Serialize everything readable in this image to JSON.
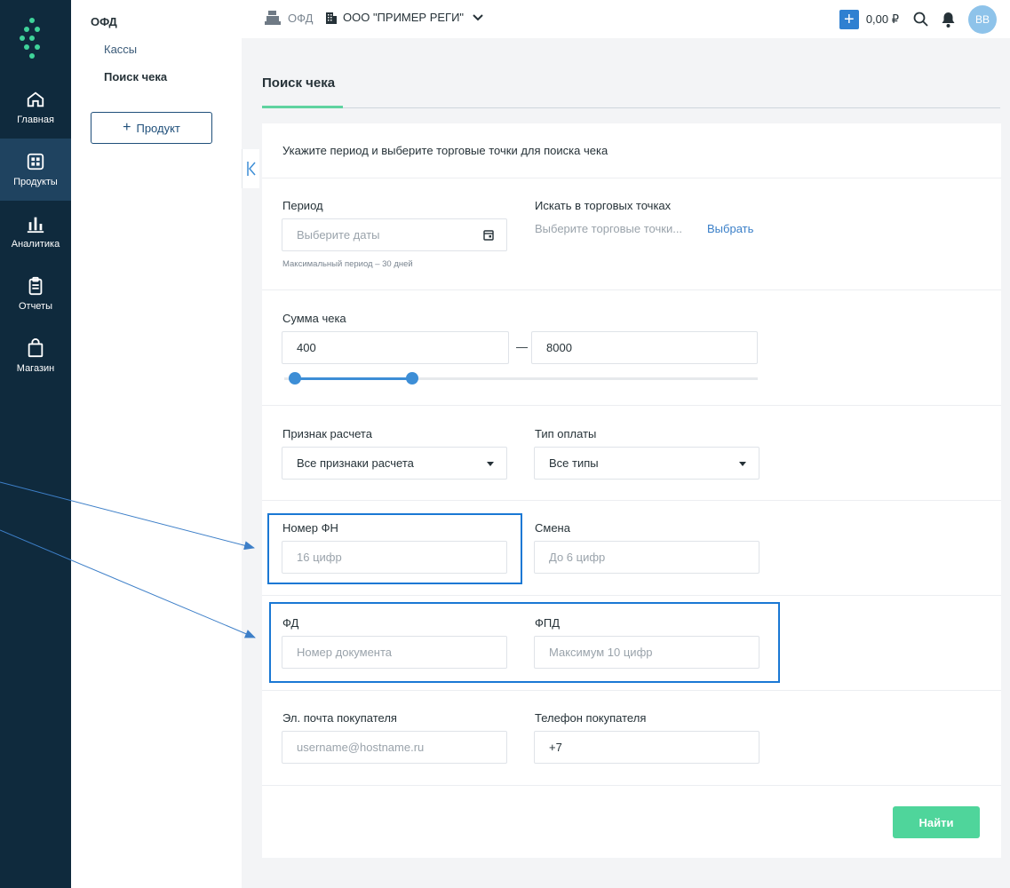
{
  "rail": {
    "items": [
      {
        "label": "Главная",
        "icon": "home-icon"
      },
      {
        "label": "Продукты",
        "icon": "grid-icon",
        "active": true
      },
      {
        "label": "Аналитика",
        "icon": "bar-chart-icon"
      },
      {
        "label": "Отчеты",
        "icon": "clipboard-icon"
      },
      {
        "label": "Магазин",
        "icon": "shopping-bag-icon"
      }
    ]
  },
  "sidebar": {
    "title": "ОФД",
    "links": [
      "Кассы",
      "Поиск чека"
    ],
    "active_link": "Поиск чека",
    "product_button": "Продукт"
  },
  "topbar": {
    "service": "ОФД",
    "organization": "ООО \"ПРИМЕР РЕГИ\"",
    "balance": "0,00 ₽",
    "avatar_initials": "BB"
  },
  "page": {
    "title": "Поиск чека"
  },
  "form": {
    "intro": "Укажите период и выберите торговые точки для поиска чека",
    "period": {
      "label": "Период",
      "placeholder": "Выберите даты",
      "hint": "Максимальный период – 30 дней"
    },
    "points": {
      "label": "Искать в торговых точках",
      "placeholder": "Выберите торговые точки...",
      "choose": "Выбрать"
    },
    "amount": {
      "label": "Сумма чека",
      "from": "400",
      "to": "8000",
      "separator": "—",
      "slider_from_fraction": 0.0,
      "slider_to_fraction": 0.27
    },
    "settlement": {
      "label": "Признак расчета",
      "value": "Все признаки расчета"
    },
    "payment": {
      "label": "Тип оплаты",
      "value": "Все типы"
    },
    "fn": {
      "label": "Номер ФН",
      "placeholder": "16 цифр"
    },
    "shift": {
      "label": "Смена",
      "placeholder": "До 6 цифр"
    },
    "fd": {
      "label": "ФД",
      "placeholder": "Номер документа"
    },
    "fpd": {
      "label": "ФПД",
      "placeholder": "Максимум 10 цифр"
    },
    "email": {
      "label": "Эл. почта покупателя",
      "placeholder": "username@hostname.ru"
    },
    "phone": {
      "label": "Телефон покупателя",
      "value": "+7"
    },
    "submit": "Найти"
  },
  "colors": {
    "rail_bg": "#0f2a3d",
    "accent_green": "#4fd59b",
    "accent_blue": "#2f80d1",
    "highlight": "#1a78d4"
  }
}
